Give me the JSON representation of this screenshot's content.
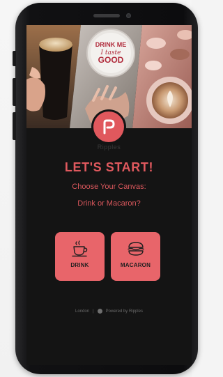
{
  "app": {
    "brand_name": "Ripples"
  },
  "main": {
    "headline": "LET'S START!",
    "subline1": "Choose Your Canvas:",
    "subline2": "Drink or Macaron?"
  },
  "choices": [
    {
      "label": "DRINK",
      "icon": "coffee-cup-icon"
    },
    {
      "label": "MACARON",
      "icon": "macaron-icon"
    }
  ],
  "footer": {
    "location": "London",
    "separator": "|",
    "powered_by": "Powered by Ripples"
  },
  "hero": {
    "sign_text": [
      "DRINK ME",
      "I taste",
      "GOOD"
    ]
  },
  "colors": {
    "accent": "#e0595e",
    "button": "#e8656a",
    "screen_bg": "#141414"
  }
}
